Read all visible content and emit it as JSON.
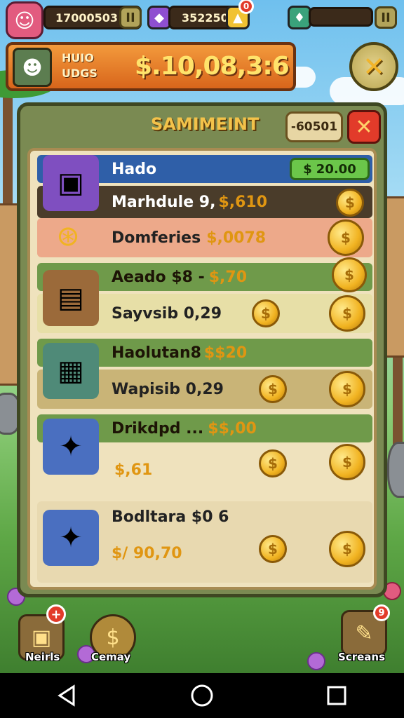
{
  "hud": {
    "coins": "17000503",
    "gems": "352250",
    "gem_badge": "0",
    "pause_label": "II",
    "pause2_label": "II"
  },
  "banner": {
    "label": "HUIO UDGS",
    "amount": "$.10,08,3:6"
  },
  "panel": {
    "title": "SAMIMEINT",
    "code": "-60501",
    "rows": [
      {
        "title": "Hado",
        "price": "20.00",
        "sub": "Marhdule 9,",
        "sub_value": "$,610"
      },
      {
        "title": "Domferies",
        "title_value": "$,0078"
      },
      {
        "title": "Aeado $8 -",
        "title_value": "$,70",
        "sub": "Sayvsib 0,29"
      },
      {
        "title": "Haolutan8",
        "title_value": "$$20",
        "sub": "Wapisib 0,29"
      },
      {
        "title": "Drikdpd ...",
        "title_value": "$$,00",
        "sub_value": "$,61"
      },
      {
        "title": "Bodltara $0 6",
        "sub_value": "$/ 90,70"
      }
    ]
  },
  "bottom": {
    "left_label": "Neirls",
    "left_badge": "+",
    "mid_label": "Cemay",
    "right_label": "Screans",
    "right_badge": "9"
  },
  "colors": {
    "banner_orange": "#e27a26",
    "coin_gold": "#f1b321",
    "price_green": "#6bc64a",
    "close_red": "#e23b2a"
  }
}
